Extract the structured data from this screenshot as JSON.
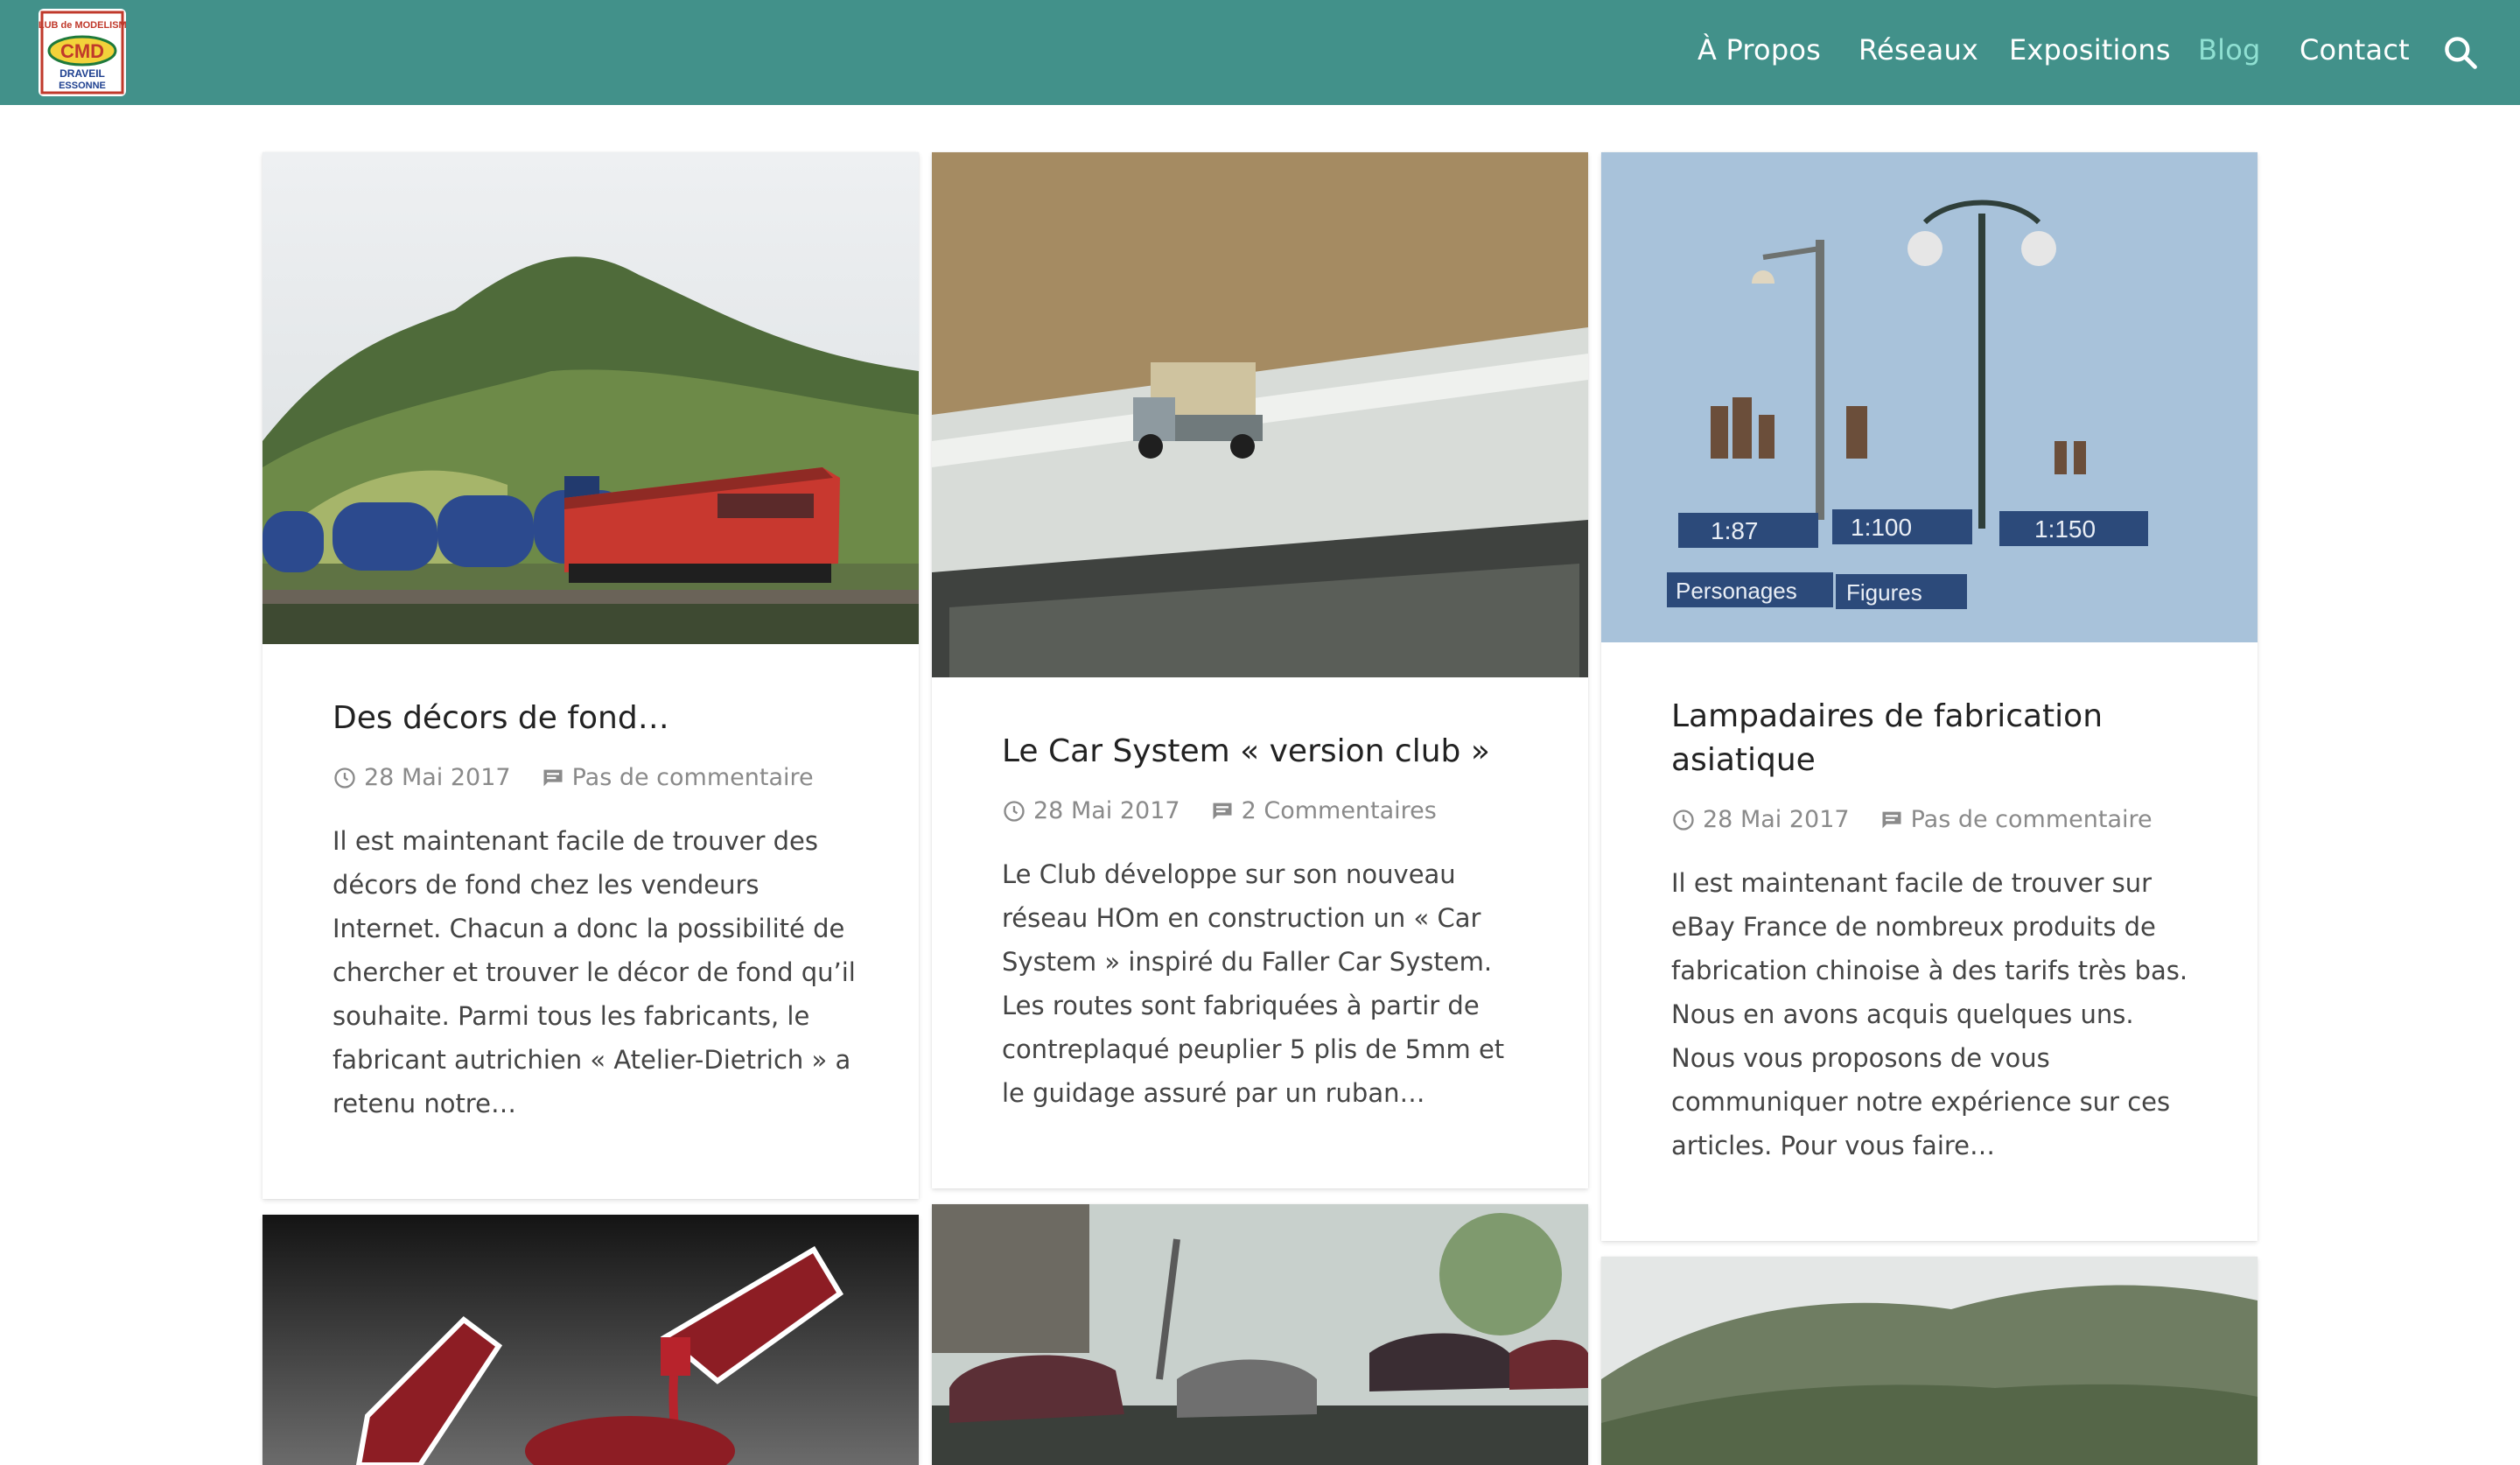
{
  "header": {
    "logo_alt": "Club de Modélisme Draveil Essonne",
    "logo_text_top": "CLUB de MODELISME",
    "logo_text_mid": "CMD",
    "logo_text_bottom1": "DRAVEIL",
    "logo_text_bottom2": "ESSONNE",
    "nav": [
      {
        "label": "À Propos"
      },
      {
        "label": "Réseaux"
      },
      {
        "label": "Expositions"
      },
      {
        "label": "Blog"
      },
      {
        "label": "Contact"
      }
    ],
    "active_nav": "Blog",
    "search_icon": "search-icon",
    "colors": {
      "bar": "#42918a",
      "active": "#8fe0d2"
    }
  },
  "posts": [
    {
      "title": "Des décors de fond…",
      "date": "28 Mai 2017",
      "comments": "Pas de commentaire",
      "excerpt": "Il est maintenant facile de trouver des décors de fond chez les vendeurs Internet. Chacun a donc la possibilité de chercher et trouver le décor de fond qu’il souhaite. Parmi tous les fabricants, le fabricant autrichien « Atelier-Dietrich » a retenu notre…"
    },
    {
      "title": "Le Car System « version club »",
      "date": "28 Mai 2017",
      "comments": "2 Commentaires",
      "excerpt": "Le Club développe sur son nouveau réseau HOm en construction un « Car System » inspiré du Faller Car System. Les routes sont fabriquées à partir de contreplaqué peuplier 5 plis de 5mm et le guidage assuré par un ruban…"
    },
    {
      "title": "Lampadaires de fabrication asiatique",
      "date": "28 Mai 2017",
      "comments": "Pas de commentaire",
      "excerpt": "Il est maintenant facile de trouver sur eBay France de nombreux produits de fabrication chinoise à des tarifs très bas. Nous en avons acquis quelques uns. Nous vous proposons de vous communiquer notre expérience sur ces articles. Pour vous faire…",
      "image_labels": {
        "s1": "1:87",
        "s2": "1:100",
        "s3": "1:150",
        "t1": "Personages",
        "t2": "Figures"
      }
    }
  ],
  "icons": {
    "date": "clock-icon",
    "comments": "comment-icon"
  }
}
